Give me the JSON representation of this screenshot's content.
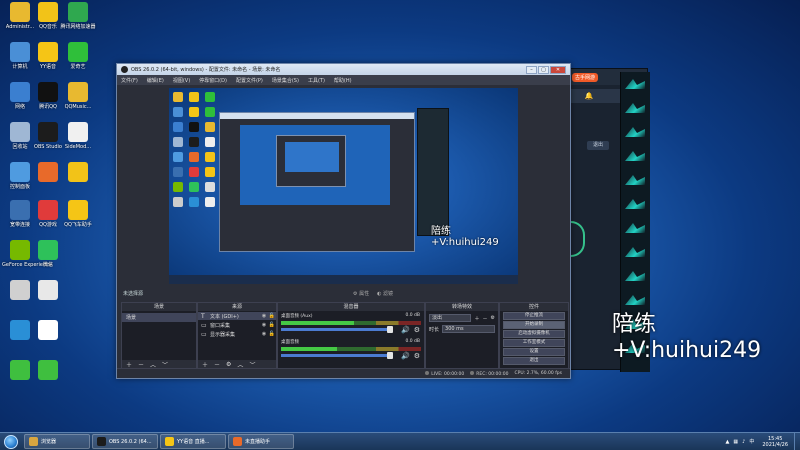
{
  "desktop": {
    "icons": [
      {
        "label": "Administr...",
        "icon": "folder-icon",
        "color": "#e8b930"
      },
      {
        "label": "QQ音乐",
        "icon": "qq-music-icon",
        "color": "#f2c318"
      },
      {
        "label": "腾讯网络加速器",
        "icon": "accelerator-icon",
        "color": "#2fa84f"
      },
      {
        "label": "计算机",
        "icon": "computer-icon",
        "color": "#4a8fd6"
      },
      {
        "label": "YY语音",
        "icon": "yy-icon",
        "color": "#f5c516"
      },
      {
        "label": "爱奇艺",
        "icon": "iqiyi-icon",
        "color": "#2fbf3a"
      },
      {
        "label": "网络",
        "icon": "network-icon",
        "color": "#3b7fd0"
      },
      {
        "label": "腾讯QQ",
        "icon": "qq-icon",
        "color": "#111111"
      },
      {
        "label": "QQMusic...",
        "icon": "file-icon",
        "color": "#e8b930"
      },
      {
        "label": "回收站",
        "icon": "recycle-bin-icon",
        "color": "#9fb7d4"
      },
      {
        "label": "OBS Studio",
        "icon": "obs-icon",
        "color": "#1c1c1c"
      },
      {
        "label": "SideMod...",
        "icon": "file-icon",
        "color": "#f0f0f0"
      },
      {
        "label": "控制面板",
        "icon": "control-panel-icon",
        "color": "#4f9be0"
      },
      {
        "label": "",
        "icon": "game-icon",
        "color": "#e86a2a"
      },
      {
        "label": "",
        "icon": "game-icon",
        "color": "#f2c318"
      },
      {
        "label": "宽带连接",
        "icon": "broadband-icon",
        "color": "#3a6fb0"
      },
      {
        "label": "QQ游戏",
        "icon": "qq-game-icon",
        "color": "#e03b3b"
      },
      {
        "label": "QQ飞车助手",
        "icon": "qq-speed-icon",
        "color": "#f5c516"
      },
      {
        "label": "GeForce Experience",
        "icon": "nvidia-icon",
        "color": "#76b900"
      },
      {
        "label": "微信",
        "icon": "wechat-icon",
        "color": "#2ec15a"
      },
      {
        "label": "",
        "icon": "",
        "color": ""
      },
      {
        "label": "",
        "icon": "file-icon",
        "color": "#d0d0d0"
      },
      {
        "label": "",
        "icon": "file-icon",
        "color": "#e8e8e8"
      },
      {
        "label": "",
        "icon": "",
        "color": ""
      },
      {
        "label": "",
        "icon": "ie-icon",
        "color": "#2a8fd6"
      },
      {
        "label": "",
        "icon": "file-icon",
        "color": "#ffffff"
      },
      {
        "label": "",
        "icon": "",
        "color": ""
      },
      {
        "label": "",
        "icon": "game-icon",
        "color": "#3fbf3f"
      },
      {
        "label": "",
        "icon": "game-icon",
        "color": "#3fbf3f"
      }
    ]
  },
  "client": {
    "tag": "古手网游",
    "button": "退出"
  },
  "watermark": "陪练+V:huihui249",
  "obs": {
    "title": "OBS 26.0.2 (64-bit, windows) - 配置文件: 未命名 - 场景: 未命名",
    "menu": [
      "文件(F)",
      "编辑(E)",
      "视图(V)",
      "停靠窗口(D)",
      "配置文件(P)",
      "场景集合(S)",
      "工具(T)",
      "帮助(H)"
    ],
    "preview_watermark": "陪练+V:huihui249",
    "no_source_label": "未选择源",
    "toolbar": {
      "properties": "属性",
      "filters": "滤镜"
    },
    "docks": {
      "scenes": "场景",
      "sources": "来源",
      "mixer": "混音器",
      "transitions": "转场特效",
      "controls": "控件"
    },
    "scenes": [
      "场景"
    ],
    "sources": [
      {
        "icon": "text-icon",
        "glyph": "T",
        "name": "文本 (GDI+)"
      },
      {
        "icon": "window-capture-icon",
        "glyph": "▭",
        "name": "窗口采集"
      },
      {
        "icon": "display-capture-icon",
        "glyph": "▭",
        "name": "显示器采集"
      }
    ],
    "mixer": [
      {
        "name": "桌面音频 (Aux)",
        "db": "0.0 dB"
      },
      {
        "name": "桌面音频",
        "db": "0.0 dB"
      }
    ],
    "transitions": {
      "type": "淡出",
      "duration_label": "时长",
      "duration": "300 ms"
    },
    "controls": [
      "停止推流",
      "开始录制",
      "启动虚拟摄像机",
      "工作室模式",
      "设置",
      "退出"
    ],
    "status": {
      "live": "LIVE: 00:00:00",
      "rec": "REC: 00:00:00",
      "cpu": "CPU: 2.7%, 60.00 fps"
    }
  },
  "taskbar": {
    "items": [
      {
        "label": "浏览器",
        "icon": "browser-icon",
        "color": "#d9a640"
      },
      {
        "label": "OBS 26.0.2 (64...",
        "icon": "obs-icon",
        "color": "#1c1c1c"
      },
      {
        "label": "YY语音 直播...",
        "icon": "yy-icon",
        "color": "#f5c516"
      },
      {
        "label": "未直播助手",
        "icon": "app-icon",
        "color": "#e86a2a"
      }
    ],
    "time": "15:45",
    "date": "2021/4/26"
  },
  "colors": {
    "desktop_blue": "#1e5fb3",
    "obs_bg": "#2b2e38",
    "accent_orange": "#f05a28"
  }
}
